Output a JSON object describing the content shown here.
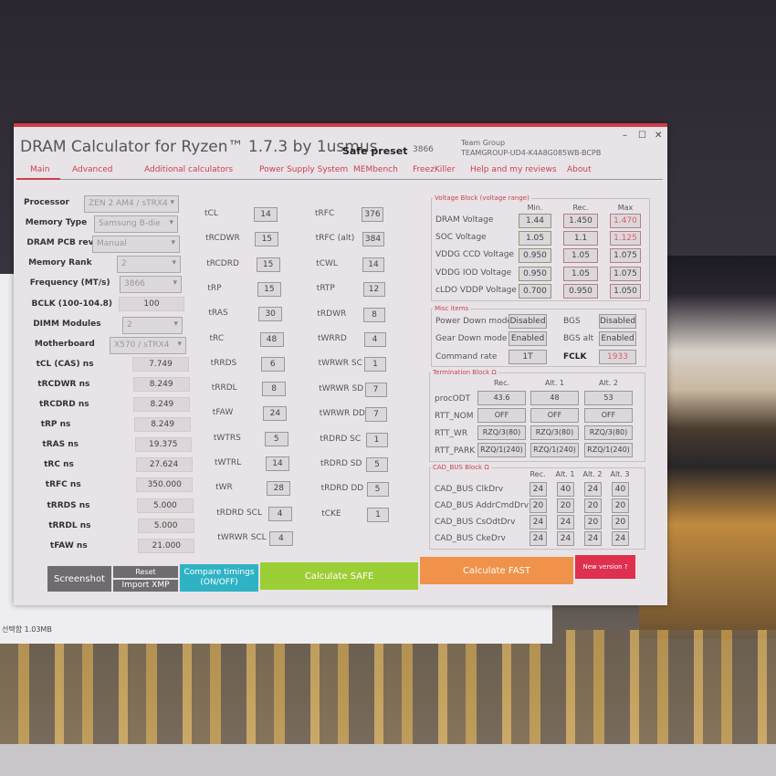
{
  "window": {
    "title": "DRAM Calculator for Ryzen™ 1.7.3 by 1usmus",
    "preset_label": "Safe preset",
    "preset_value": "3866",
    "vendor": "Team Group",
    "part": "TEAMGROUP-UD4-K4A8G085WB-BCPB",
    "controls": [
      "–",
      "☐",
      "✕"
    ]
  },
  "tabs": [
    "Main",
    "Advanced",
    "Additional calculators",
    "Power Supply System",
    "MEMbench",
    "FreezKiller",
    "Help and my reviews",
    "About"
  ],
  "settings": [
    {
      "label": "Processor",
      "value": "ZEN 2 AM4 / sTRX4",
      "type": "select"
    },
    {
      "label": "Memory Type",
      "value": "Samsung B-die",
      "type": "select"
    },
    {
      "label": "DRAM PCB revision",
      "value": "Manual",
      "type": "select"
    },
    {
      "label": "Memory Rank",
      "value": "2",
      "type": "select"
    },
    {
      "label": "Frequency (MT/s)",
      "value": "3866",
      "type": "select"
    },
    {
      "label": "BCLK (100-104.8)",
      "value": "100",
      "type": "input"
    },
    {
      "label": "DIMM Modules",
      "value": "2",
      "type": "select"
    },
    {
      "label": "Motherboard",
      "value": "X570 / sTRX4",
      "type": "select"
    },
    {
      "label": "tCL (CAS) ns",
      "value": "7.749",
      "type": "value"
    },
    {
      "label": "tRCDWR ns",
      "value": "8.249",
      "type": "value"
    },
    {
      "label": "tRCDRD ns",
      "value": "8.249",
      "type": "value"
    },
    {
      "label": "tRP ns",
      "value": "8.249",
      "type": "value"
    },
    {
      "label": "tRAS ns",
      "value": "19.375",
      "type": "value"
    },
    {
      "label": "tRC ns",
      "value": "27.624",
      "type": "value"
    },
    {
      "label": "tRFC ns",
      "value": "350.000",
      "type": "value"
    },
    {
      "label": "tRRDS ns",
      "value": "5.000",
      "type": "value"
    },
    {
      "label": "tRRDL ns",
      "value": "5.000",
      "type": "value"
    },
    {
      "label": "tFAW ns",
      "value": "21.000",
      "type": "value"
    }
  ],
  "timings_a": [
    [
      "tCL",
      "14"
    ],
    [
      "tRCDWR",
      "15"
    ],
    [
      "tRCDRD",
      "15"
    ],
    [
      "tRP",
      "15"
    ],
    [
      "tRAS",
      "30"
    ],
    [
      "tRC",
      "48"
    ],
    [
      "tRRDS",
      "6"
    ],
    [
      "tRRDL",
      "8"
    ],
    [
      "tFAW",
      "24"
    ],
    [
      "tWTRS",
      "5"
    ],
    [
      "tWTRL",
      "14"
    ],
    [
      "tWR",
      "28"
    ],
    [
      "tRDRD SCL",
      "4"
    ],
    [
      "tWRWR SCL",
      "4"
    ]
  ],
  "timings_b": [
    [
      "tRFC",
      "376"
    ],
    [
      "tRFC (alt)",
      "384"
    ],
    [
      "tCWL",
      "14"
    ],
    [
      "tRTP",
      "12"
    ],
    [
      "tRDWR",
      "8"
    ],
    [
      "tWRRD",
      "4"
    ],
    [
      "tWRWR SC",
      "1"
    ],
    [
      "tWRWR SD",
      "7"
    ],
    [
      "tWRWR DD",
      "7"
    ],
    [
      "tRDRD SC",
      "1"
    ],
    [
      "tRDRD SD",
      "5"
    ],
    [
      "tRDRD DD",
      "5"
    ],
    [
      "tCKE",
      "1"
    ]
  ],
  "voltage": {
    "title": "Voltage Block (voltage range)",
    "headers": [
      "Min.",
      "Rec.",
      "Max"
    ],
    "rows": [
      [
        "DRAM Voltage",
        "1.44",
        "1.450",
        "1.470"
      ],
      [
        "SOC Voltage",
        "1.05",
        "1.1",
        "1.125"
      ],
      [
        "VDDG  CCD Voltage",
        "0.950",
        "1.05",
        "1.075"
      ],
      [
        "VDDG  IOD Voltage",
        "0.950",
        "1.05",
        "1.075"
      ],
      [
        "cLDO VDDP Voltage",
        "0.700",
        "0.950",
        "1.050"
      ]
    ]
  },
  "misc": {
    "title": "Misc items",
    "rows": [
      [
        "Power Down mode",
        "Disabled",
        "BGS",
        "Disabled"
      ],
      [
        "Gear Down mode",
        "Enabled",
        "BGS alt",
        "Enabled"
      ],
      [
        "Command rate",
        "1T",
        "FCLK",
        "1933"
      ]
    ]
  },
  "termination": {
    "title": "Termination Block Ω",
    "headers": [
      "Rec.",
      "Alt. 1",
      "Alt. 2"
    ],
    "rows": [
      [
        "procODT",
        "43.6",
        "48",
        "53"
      ],
      [
        "RTT_NOM",
        "OFF",
        "OFF",
        "OFF"
      ],
      [
        "RTT_WR",
        "RZQ/3(80)",
        "RZQ/3(80)",
        "RZQ/3(80)"
      ],
      [
        "RTT_PARK",
        "RZQ/1(240)",
        "RZQ/1(240)",
        "RZQ/1(240)"
      ]
    ]
  },
  "cadbus": {
    "title": "CAD_BUS Block Ω",
    "headers": [
      "Rec.",
      "Alt. 1",
      "Alt. 2",
      "Alt. 3"
    ],
    "rows": [
      [
        "CAD_BUS ClkDrv",
        "24",
        "40",
        "24",
        "40"
      ],
      [
        "CAD_BUS AddrCmdDrv",
        "20",
        "20",
        "20",
        "20"
      ],
      [
        "CAD_BUS CsOdtDrv",
        "24",
        "24",
        "20",
        "20"
      ],
      [
        "CAD_BUS CkeDrv",
        "24",
        "24",
        "24",
        "24"
      ]
    ]
  },
  "buttons": {
    "screenshot": "Screenshot",
    "reset": "Reset",
    "import": "Import XMP",
    "compare": "Compare timings (ON/OFF)",
    "safe": "Calculate SAFE",
    "fast": "Calculate FAST",
    "new_version": "New version ?"
  },
  "colors": {
    "accent": "#d23a46",
    "compare": "#2fb3c4",
    "safe": "#9bcf35",
    "fast": "#f0924a",
    "new_version": "#e0304f",
    "max_voltage_text": "#d9606a"
  },
  "behind_window": {
    "status": "선택함 1.03MB"
  }
}
